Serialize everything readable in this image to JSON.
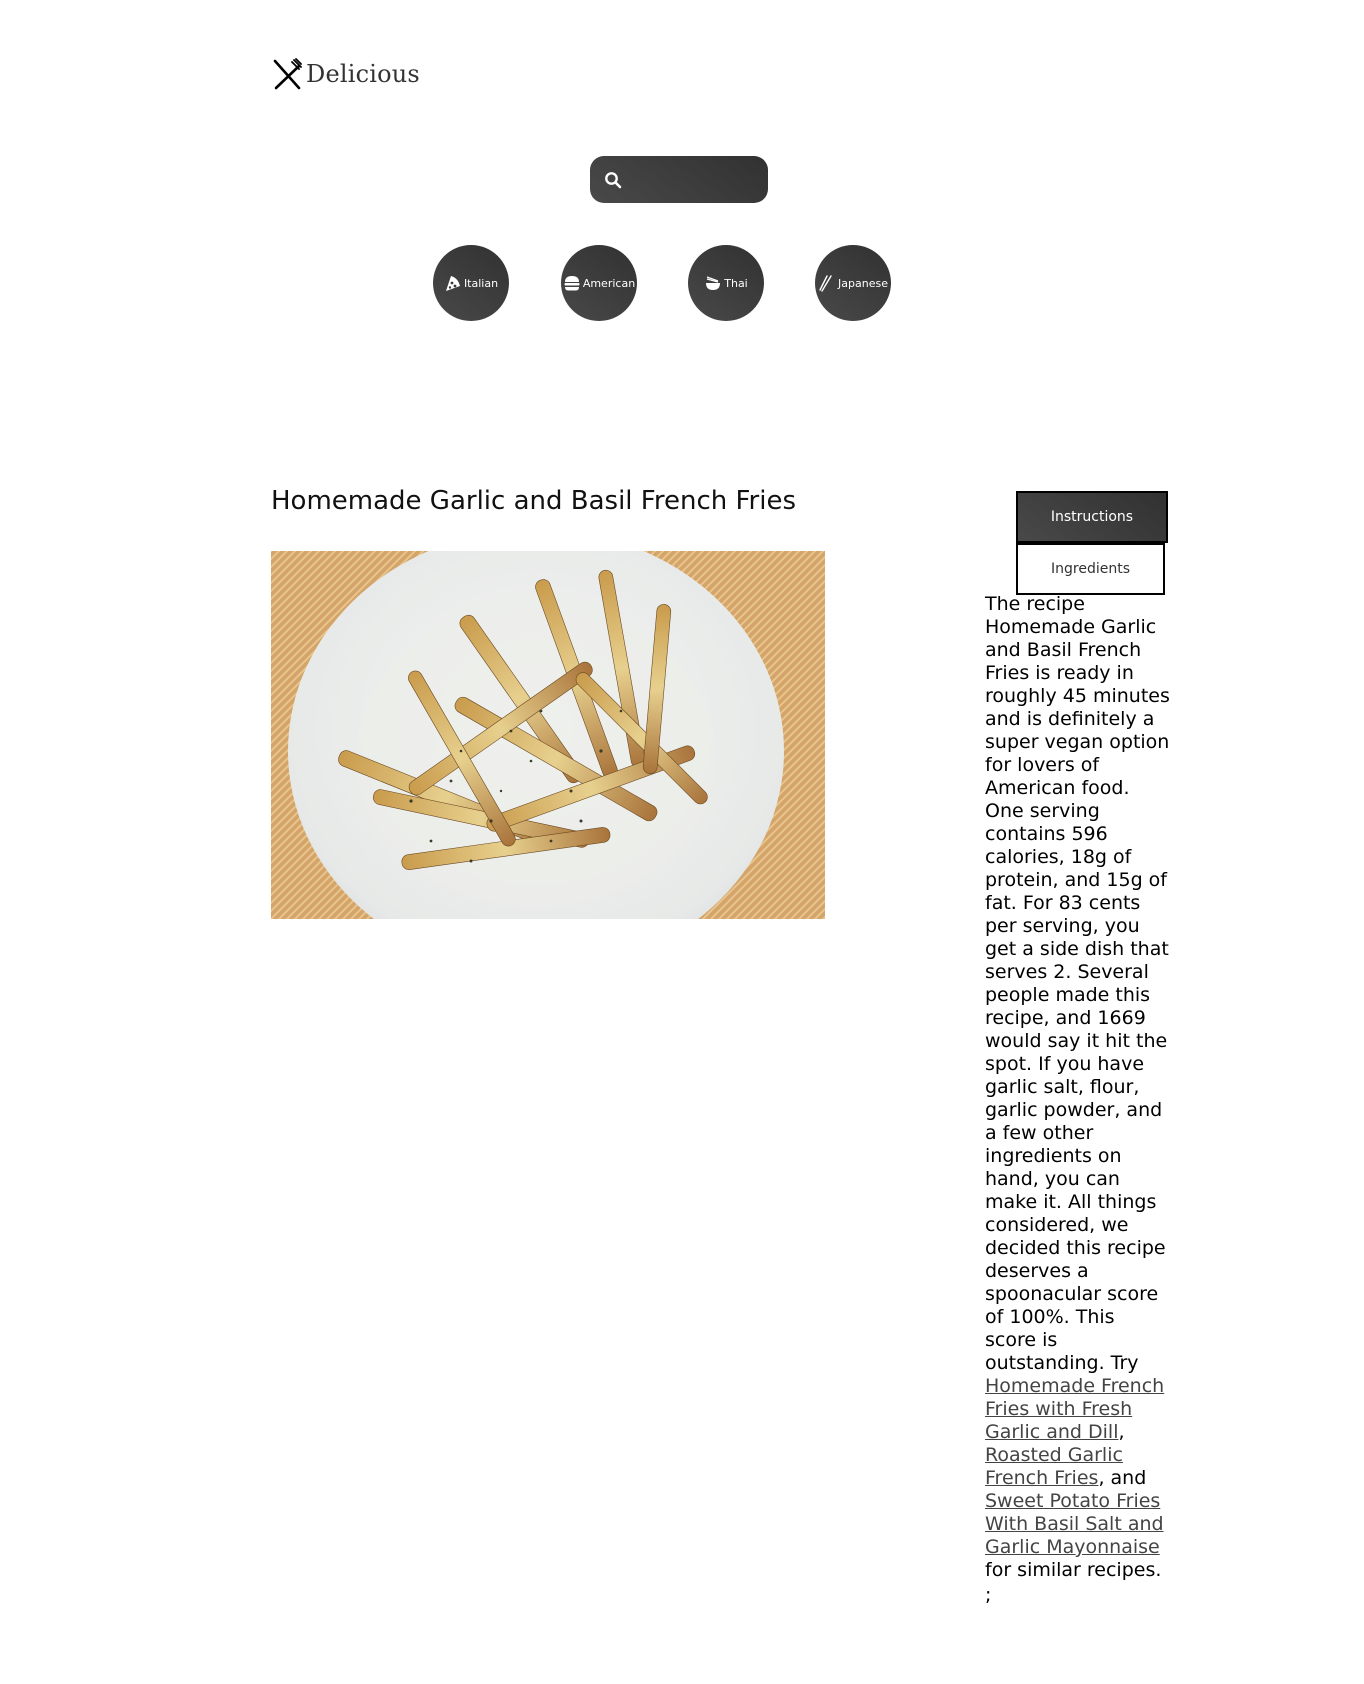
{
  "brand": {
    "name": "Delicious",
    "icon": "fork-knife-icon"
  },
  "search": {
    "placeholder": "",
    "value": "",
    "icon": "search-icon"
  },
  "categories": [
    {
      "label": "Italian",
      "icon": "pizza-icon"
    },
    {
      "label": "American",
      "icon": "hamburger-icon"
    },
    {
      "label": "Thai",
      "icon": "noodle-bowl-icon"
    },
    {
      "label": "Japanese",
      "icon": "chopsticks-icon"
    }
  ],
  "recipe": {
    "title": "Homemade Garlic and Basil French Fries",
    "image_alt": "Homemade Garlic and Basil French Fries"
  },
  "tabs": {
    "active": "Instructions",
    "inactive": "Ingredients"
  },
  "summary": {
    "intro": "The recipe Homemade Garlic and Basil French Fries is ready in roughly 45 minutes and is definitely a super vegan option for lovers of American food. One serving contains 596 calories, 18g of protein, and 15g of fat. For 83 cents per serving, you get a side dish that serves 2. Several people made this recipe, and 1669 would say it hit the spot. If you have garlic salt, flour, garlic powder, and a few other ingredients on hand, you can make it. All things considered, we decided this recipe deserves a spoonacular score of 100%. This score is outstanding. Try ",
    "link1": "Homemade French Fries with Fresh Garlic and Dill",
    "sep1": ", ",
    "link2": "Roasted Garlic French Fries",
    "sep2": ", and ",
    "link3": "Sweet Potato Fries With Basil Salt and Garlic Mayonnaise",
    "outro": " for similar recipes.",
    "trailing": ";"
  },
  "colors": {
    "dark_gradient_start": "#494949",
    "dark_gradient_end": "#313131",
    "link": "#444444"
  }
}
